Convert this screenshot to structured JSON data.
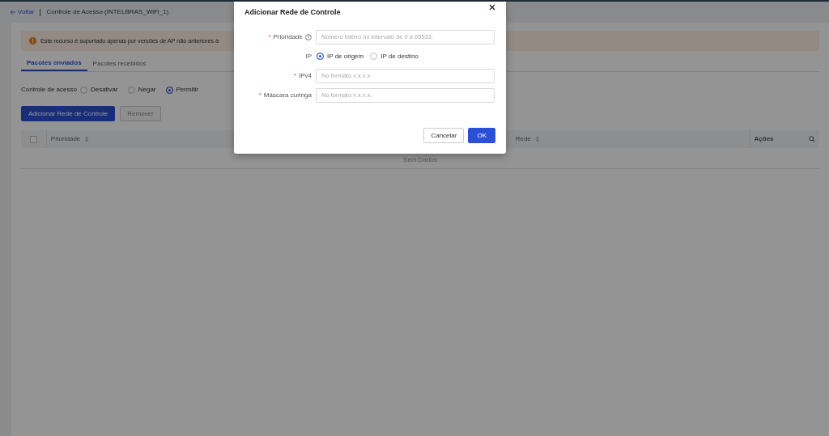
{
  "header": {
    "back_link": "Voltar",
    "title": "Controle de Acesso (INTELBRAS_WiFi_1)"
  },
  "alert": {
    "text": "Este recurso é suportado apenas por versões de AP não anteriores à"
  },
  "tabs": [
    {
      "label": "Pacotes enviados",
      "selected": true
    },
    {
      "label": "Pacotes recebidos",
      "selected": false
    }
  ],
  "access_control": {
    "label": "Controle de acesso",
    "options": [
      {
        "label": "Desativar",
        "selected": false
      },
      {
        "label": "Negar",
        "selected": false
      },
      {
        "label": "Permitir",
        "selected": true
      }
    ]
  },
  "buttons": [
    {
      "label": "Adicionar Rede de Controle",
      "disabled": false
    },
    {
      "label": "Remover",
      "disabled": true
    }
  ],
  "table": {
    "select_all_checked": false,
    "columns": [
      {
        "label": "Prioridade",
        "sortable": true
      },
      {
        "label": "Rede",
        "sortable": true
      },
      {
        "label": "Ações",
        "sortable": false
      }
    ],
    "empty_text": "Sem Dados"
  },
  "dialog": {
    "title": "Adicionar Rede de Controle",
    "fields": [
      {
        "kind": "input",
        "required_mark": "*",
        "label": "Prioridade",
        "help": true,
        "placeholder": "Número inteiro no intervalo de 0 a 65533."
      },
      {
        "kind": "radio",
        "label": "IP",
        "options": [
          {
            "label": "IP de origem",
            "selected": true
          },
          {
            "label": "IP de destino",
            "selected": false
          }
        ]
      },
      {
        "kind": "input",
        "required_mark": "*",
        "label": "IPv4",
        "help": false,
        "placeholder": "No formato x.x.x.x."
      },
      {
        "kind": "input",
        "required_mark": "*",
        "label": "Máscara curinga",
        "help": false,
        "placeholder": "No formato x.x.x.x."
      }
    ],
    "buttons": [
      {
        "label": "Cancelar",
        "primary": false
      },
      {
        "label": "OK",
        "primary": true
      }
    ]
  }
}
